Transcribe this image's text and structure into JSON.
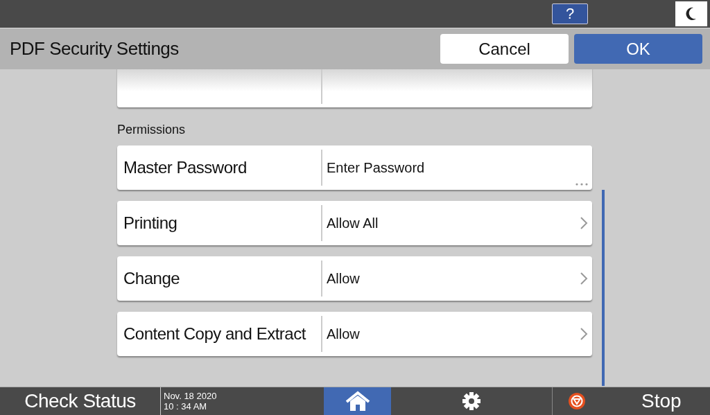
{
  "top_bar": {
    "help_label": "?"
  },
  "header": {
    "title": "PDF Security Settings",
    "cancel": "Cancel",
    "ok": "OK"
  },
  "section_label": "Permissions",
  "rows": [
    {
      "kind": "text",
      "label": "Master Password",
      "value": "Enter Password"
    },
    {
      "kind": "select",
      "label": "Printing",
      "value": "Allow All"
    },
    {
      "kind": "select",
      "label": "Change",
      "value": "Allow"
    },
    {
      "kind": "select",
      "label": "Content Copy and Extract",
      "value": "Allow"
    }
  ],
  "footer": {
    "check_status": "Check Status",
    "date": "Nov. 18 2020",
    "time": "10 : 34 AM",
    "home_selected": true,
    "stop": "Stop"
  }
}
